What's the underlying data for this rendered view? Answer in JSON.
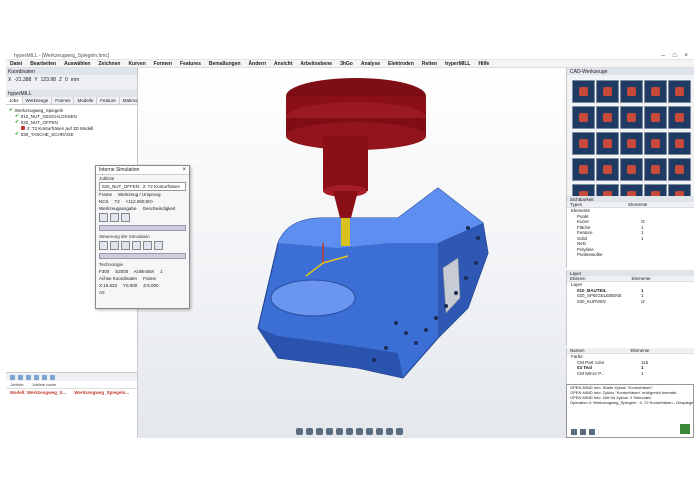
{
  "window": {
    "title": "hyperMILL - [Werkzeugweg_Spiegeln.hmc]",
    "controls": [
      "–",
      "□",
      "×"
    ]
  },
  "menu": [
    "Datei",
    "Bearbeiten",
    "Auswählen",
    "Zeichnen",
    "Kurven",
    "Formen",
    "Features",
    "Bemaßungen",
    "Ändern",
    "Ansicht",
    "Arbeitsebene",
    "3hGo",
    "Analyse",
    "Elektroden",
    "Reiten",
    "hyperMILL",
    "Hilfe"
  ],
  "coords": {
    "header": "Koordinaten",
    "x_label": "X",
    "x_value": "-21.388",
    "y_label": "Y",
    "y_value": "123.98",
    "z_label": "Z",
    "z_value": "0",
    "unit": "mm"
  },
  "hypermill": {
    "header": "hyperMILL",
    "tabs": [
      "Jobs",
      "Werkzeuge",
      "Frames",
      "Modelle",
      "Feature",
      "Makros"
    ],
    "tree": [
      {
        "label": "Werkzeugweg_Spiegeln"
      },
      {
        "label": "010_NUT_GESCHLOSSEN"
      },
      {
        "label": "020_NUT_OFFEN"
      },
      {
        "label": "2: T2 Konturfräsen auf 3D Modell"
      },
      {
        "label": "030_TASCHE_SCHRÄGE"
      }
    ],
    "bottom_cols": [
      "Jobliste",
      "Jobliste name"
    ],
    "bottom_job": {
      "label": "Modell: Werkzeugweg_S...",
      "name": "Werkzeugweg_Spiegeln..."
    }
  },
  "sim": {
    "title": "Interne Simulation",
    "joblist_label": "Jobliste",
    "joblist_value": "020_NUT_OFFEN : 2: T2 Konturfräsen",
    "frame_label": "Frame",
    "tool_label": "Werkzeug / Ursprung",
    "frame_value": "NCS",
    "tool_value": "T2",
    "tool_origin": "<112.060;60>",
    "tool_output_label": "Werkzeugausgabe",
    "speed_label": "Geschwindigkeit",
    "control_label": "Steuerung der Simulation",
    "tech_label": "Technologie",
    "feed": "F300",
    "spindle": "S2000",
    "coolant_label": "Kühlmittel",
    "coolant": "1",
    "axes_label": "Achse Koordinaten",
    "frame_check": "Frame",
    "x": "X:16.833",
    "y": "Y0.000",
    "z": "Z:5.000",
    "a": "A0"
  },
  "cad": {
    "header": "CAD-Werkzeuge",
    "tools": 30
  },
  "panel_sichtbarkeit": {
    "header": "Sichtbarkeit",
    "cols": [
      "Typen",
      "Elemente"
    ],
    "rows": [
      {
        "n": "Elemente",
        "v": ""
      },
      {
        "n": "Punkt",
        "v": ""
      },
      {
        "n": "Kurve",
        "v": "/2"
      },
      {
        "n": "Fläche",
        "v": "1"
      },
      {
        "n": "Feature",
        "v": "1"
      },
      {
        "n": "Solid",
        "v": "1"
      },
      {
        "n": "Netz",
        "v": ""
      },
      {
        "n": "Polylinie",
        "v": ""
      },
      {
        "n": "Punktewolke",
        "v": ""
      }
    ]
  },
  "panel_layer": {
    "header": "Layer",
    "cols": [
      "Ebenen",
      "Elemente"
    ],
    "rows": [
      {
        "n": "Layer",
        "v": ""
      },
      {
        "n": "010_BAUTEIL",
        "v": "1"
      },
      {
        "n": "020_SPIEGELEBENE",
        "v": "1"
      },
      {
        "n": "030_KURVEN",
        "v": "/2"
      }
    ]
  },
  "panel_namen": {
    "header": "Namen",
    "cols": [
      "Namen",
      "Elemente"
    ],
    "rows": [
      {
        "n": "Farbe",
        "v": ""
      },
      {
        "n": "CM Part color",
        "v": "115"
      },
      {
        "n": "03 Teal",
        "v": "1"
      },
      {
        "n": "CM Mirror P...",
        "v": "1"
      }
    ]
  },
  "log": [
    "OPEN MIND Info:  Starte Zyklus \"Konturfräsen\"",
    "OPEN MIND Info:  Zyklus \"Konturfräsen\" erfolgreich beendet",
    "OPEN MIND Info:  Zeit für Zyklus: 0 Sekunden",
    "Operation 4: Werkzeugweg_Spiegeln : 4: T2 Konturfräsen - Gespiegelt"
  ],
  "colors": {
    "accent": "#2a6fb8",
    "model_blue": "#3b6fd6",
    "spindle_red": "#8b0f17"
  }
}
